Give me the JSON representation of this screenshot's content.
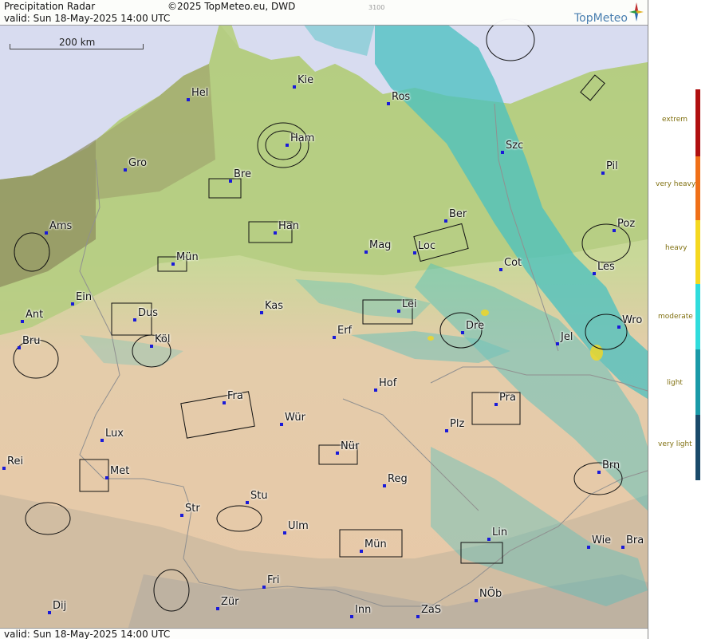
{
  "header": {
    "title": "Precipitation Radar",
    "copyright": "©2025 TopMeteo.eu, DWD",
    "valid": "valid:  Sun  18-May-2025 14:00 UTC",
    "code": "3100",
    "brand": "TopMeteo"
  },
  "footer": {
    "valid": "valid:  Sun  18-May-2025 14:00 UTC"
  },
  "scale": {
    "label": "200 km"
  },
  "cities": [
    {
      "name": "Hel"
    },
    {
      "name": "Kie"
    },
    {
      "name": "Ros"
    },
    {
      "name": "Ham"
    },
    {
      "name": "Szc"
    },
    {
      "name": "Gro"
    },
    {
      "name": "Bre"
    },
    {
      "name": "Pil"
    },
    {
      "name": "Ber"
    },
    {
      "name": "Ams"
    },
    {
      "name": "Han"
    },
    {
      "name": "Poz"
    },
    {
      "name": "Mag"
    },
    {
      "name": "Loc"
    },
    {
      "name": "Mün"
    },
    {
      "name": "Cot"
    },
    {
      "name": "Les"
    },
    {
      "name": "Ein"
    },
    {
      "name": "Kas"
    },
    {
      "name": "Lei"
    },
    {
      "name": "Ant"
    },
    {
      "name": "Dus"
    },
    {
      "name": "Dre"
    },
    {
      "name": "Wro"
    },
    {
      "name": "Erf"
    },
    {
      "name": "Bru"
    },
    {
      "name": "Köl"
    },
    {
      "name": "Jel"
    },
    {
      "name": "Hof"
    },
    {
      "name": "Fra"
    },
    {
      "name": "Pra"
    },
    {
      "name": "Wür"
    },
    {
      "name": "Plz"
    },
    {
      "name": "Lux"
    },
    {
      "name": "Nür"
    },
    {
      "name": "Rei"
    },
    {
      "name": "Met"
    },
    {
      "name": "Reg"
    },
    {
      "name": "Brn"
    },
    {
      "name": "Stu"
    },
    {
      "name": "Str"
    },
    {
      "name": "Ulm"
    },
    {
      "name": "Lin"
    },
    {
      "name": "Mün"
    },
    {
      "name": "Wie"
    },
    {
      "name": "Bra"
    },
    {
      "name": "Fri"
    },
    {
      "name": "NÖb"
    },
    {
      "name": "Dij"
    },
    {
      "name": "Zür"
    },
    {
      "name": "Inn"
    },
    {
      "name": "ZaS"
    }
  ],
  "legend": {
    "items": [
      {
        "label": "extrem",
        "color": "#b01010"
      },
      {
        "label": "very heavy",
        "color": "#f07018"
      },
      {
        "label": "heavy",
        "color": "#f5d820"
      },
      {
        "label": "moderate",
        "color": "#30dcdc"
      },
      {
        "label": "light",
        "color": "#1a9aa8"
      },
      {
        "label": "very light",
        "color": "#1a4a6a"
      }
    ]
  },
  "colors": {
    "sea": "#d8dcf0",
    "lowland": "#a8c878",
    "upland": "#e8c8a8",
    "rain": "#48c0c0",
    "city_dot": "#1a1ad8"
  }
}
